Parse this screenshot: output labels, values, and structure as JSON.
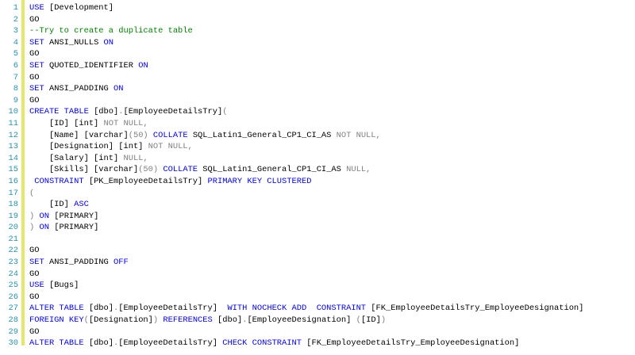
{
  "editor": {
    "colors": {
      "keyword": "#0000ff",
      "operator": "#808080",
      "comment": "#008000",
      "text": "#000000",
      "line_number": "#2b91af",
      "change_bar": "#e2e86a"
    },
    "lines": [
      {
        "n": "1",
        "tokens": [
          {
            "t": "USE",
            "c": "kw"
          },
          {
            "t": " [Development]",
            "c": "tx"
          }
        ]
      },
      {
        "n": "2",
        "tokens": [
          {
            "t": "GO",
            "c": "tx"
          }
        ]
      },
      {
        "n": "3",
        "tokens": [
          {
            "t": "--Try to create a duplicate table",
            "c": "cm"
          }
        ]
      },
      {
        "n": "4",
        "tokens": [
          {
            "t": "SET",
            "c": "kw"
          },
          {
            "t": " ANSI_NULLS ",
            "c": "tx"
          },
          {
            "t": "ON",
            "c": "kw"
          }
        ]
      },
      {
        "n": "5",
        "tokens": [
          {
            "t": "GO",
            "c": "tx"
          }
        ]
      },
      {
        "n": "6",
        "tokens": [
          {
            "t": "SET",
            "c": "kw"
          },
          {
            "t": " QUOTED_IDENTIFIER ",
            "c": "tx"
          },
          {
            "t": "ON",
            "c": "kw"
          }
        ]
      },
      {
        "n": "7",
        "tokens": [
          {
            "t": "GO",
            "c": "tx"
          }
        ]
      },
      {
        "n": "8",
        "tokens": [
          {
            "t": "SET",
            "c": "kw"
          },
          {
            "t": " ANSI_PADDING ",
            "c": "tx"
          },
          {
            "t": "ON",
            "c": "kw"
          }
        ]
      },
      {
        "n": "9",
        "tokens": [
          {
            "t": "GO",
            "c": "tx"
          }
        ]
      },
      {
        "n": "10",
        "tokens": [
          {
            "t": "CREATE TABLE",
            "c": "kw"
          },
          {
            "t": " [dbo]",
            "c": "tx"
          },
          {
            "t": ".",
            "c": "gr"
          },
          {
            "t": "[EmployeeDetailsTry]",
            "c": "tx"
          },
          {
            "t": "(",
            "c": "gr"
          }
        ]
      },
      {
        "n": "11",
        "tokens": [
          {
            "t": "    [ID] [int] ",
            "c": "tx"
          },
          {
            "t": "NOT NULL,",
            "c": "gr"
          }
        ]
      },
      {
        "n": "12",
        "tokens": [
          {
            "t": "    [Name] [varchar]",
            "c": "tx"
          },
          {
            "t": "(50)",
            "c": "gr"
          },
          {
            "t": " ",
            "c": "tx"
          },
          {
            "t": "COLLATE",
            "c": "kw"
          },
          {
            "t": " SQL_Latin1_General_CP1_CI_AS ",
            "c": "tx"
          },
          {
            "t": "NOT NULL,",
            "c": "gr"
          }
        ]
      },
      {
        "n": "13",
        "tokens": [
          {
            "t": "    [Designation] [int] ",
            "c": "tx"
          },
          {
            "t": "NOT NULL,",
            "c": "gr"
          }
        ]
      },
      {
        "n": "14",
        "tokens": [
          {
            "t": "    [Salary] [int] ",
            "c": "tx"
          },
          {
            "t": "NULL,",
            "c": "gr"
          }
        ]
      },
      {
        "n": "15",
        "tokens": [
          {
            "t": "    [Skills] [varchar]",
            "c": "tx"
          },
          {
            "t": "(50)",
            "c": "gr"
          },
          {
            "t": " ",
            "c": "tx"
          },
          {
            "t": "COLLATE",
            "c": "kw"
          },
          {
            "t": " SQL_Latin1_General_CP1_CI_AS ",
            "c": "tx"
          },
          {
            "t": "NULL,",
            "c": "gr"
          }
        ]
      },
      {
        "n": "16",
        "tokens": [
          {
            "t": " CONSTRAINT",
            "c": "kw"
          },
          {
            "t": " [PK_EmployeeDetailsTry] ",
            "c": "tx"
          },
          {
            "t": "PRIMARY KEY CLUSTERED",
            "c": "kw"
          }
        ]
      },
      {
        "n": "17",
        "tokens": [
          {
            "t": "(",
            "c": "gr"
          }
        ]
      },
      {
        "n": "18",
        "tokens": [
          {
            "t": "    [ID] ",
            "c": "tx"
          },
          {
            "t": "ASC",
            "c": "kw"
          }
        ]
      },
      {
        "n": "19",
        "tokens": [
          {
            "t": ")",
            "c": "gr"
          },
          {
            "t": " ",
            "c": "tx"
          },
          {
            "t": "ON",
            "c": "kw"
          },
          {
            "t": " [PRIMARY]",
            "c": "tx"
          }
        ]
      },
      {
        "n": "20",
        "tokens": [
          {
            "t": ")",
            "c": "gr"
          },
          {
            "t": " ",
            "c": "tx"
          },
          {
            "t": "ON",
            "c": "kw"
          },
          {
            "t": " [PRIMARY]",
            "c": "tx"
          }
        ]
      },
      {
        "n": "21",
        "tokens": []
      },
      {
        "n": "22",
        "tokens": [
          {
            "t": "GO",
            "c": "tx"
          }
        ]
      },
      {
        "n": "23",
        "tokens": [
          {
            "t": "SET",
            "c": "kw"
          },
          {
            "t": " ANSI_PADDING ",
            "c": "tx"
          },
          {
            "t": "OFF",
            "c": "kw"
          }
        ]
      },
      {
        "n": "24",
        "tokens": [
          {
            "t": "GO",
            "c": "tx"
          }
        ]
      },
      {
        "n": "25",
        "tokens": [
          {
            "t": "USE",
            "c": "kw"
          },
          {
            "t": " [Bugs]",
            "c": "tx"
          }
        ]
      },
      {
        "n": "26",
        "tokens": [
          {
            "t": "GO",
            "c": "tx"
          }
        ]
      },
      {
        "n": "27",
        "tokens": [
          {
            "t": "ALTER TABLE",
            "c": "kw"
          },
          {
            "t": " [dbo]",
            "c": "tx"
          },
          {
            "t": ".",
            "c": "gr"
          },
          {
            "t": "[EmployeeDetailsTry]  ",
            "c": "tx"
          },
          {
            "t": "WITH NOCHECK ADD  CONSTRAINT",
            "c": "kw"
          },
          {
            "t": " [FK_EmployeeDetailsTry_EmployeeDesignation]",
            "c": "tx"
          }
        ]
      },
      {
        "n": "28",
        "tokens": [
          {
            "t": "FOREIGN KEY",
            "c": "kw"
          },
          {
            "t": "(",
            "c": "gr"
          },
          {
            "t": "[Designation]",
            "c": "tx"
          },
          {
            "t": ")",
            "c": "gr"
          },
          {
            "t": " ",
            "c": "tx"
          },
          {
            "t": "REFERENCES",
            "c": "kw"
          },
          {
            "t": " [dbo]",
            "c": "tx"
          },
          {
            "t": ".",
            "c": "gr"
          },
          {
            "t": "[EmployeeDesignation] ",
            "c": "tx"
          },
          {
            "t": "(",
            "c": "gr"
          },
          {
            "t": "[ID]",
            "c": "tx"
          },
          {
            "t": ")",
            "c": "gr"
          }
        ]
      },
      {
        "n": "29",
        "tokens": [
          {
            "t": "GO",
            "c": "tx"
          }
        ]
      },
      {
        "n": "30",
        "tokens": [
          {
            "t": "ALTER TABLE",
            "c": "kw"
          },
          {
            "t": " [dbo]",
            "c": "tx"
          },
          {
            "t": ".",
            "c": "gr"
          },
          {
            "t": "[EmployeeDetailsTry] ",
            "c": "tx"
          },
          {
            "t": "CHECK CONSTRAINT",
            "c": "kw"
          },
          {
            "t": " [FK_EmployeeDetailsTry_EmployeeDesignation]",
            "c": "tx"
          }
        ]
      }
    ]
  }
}
